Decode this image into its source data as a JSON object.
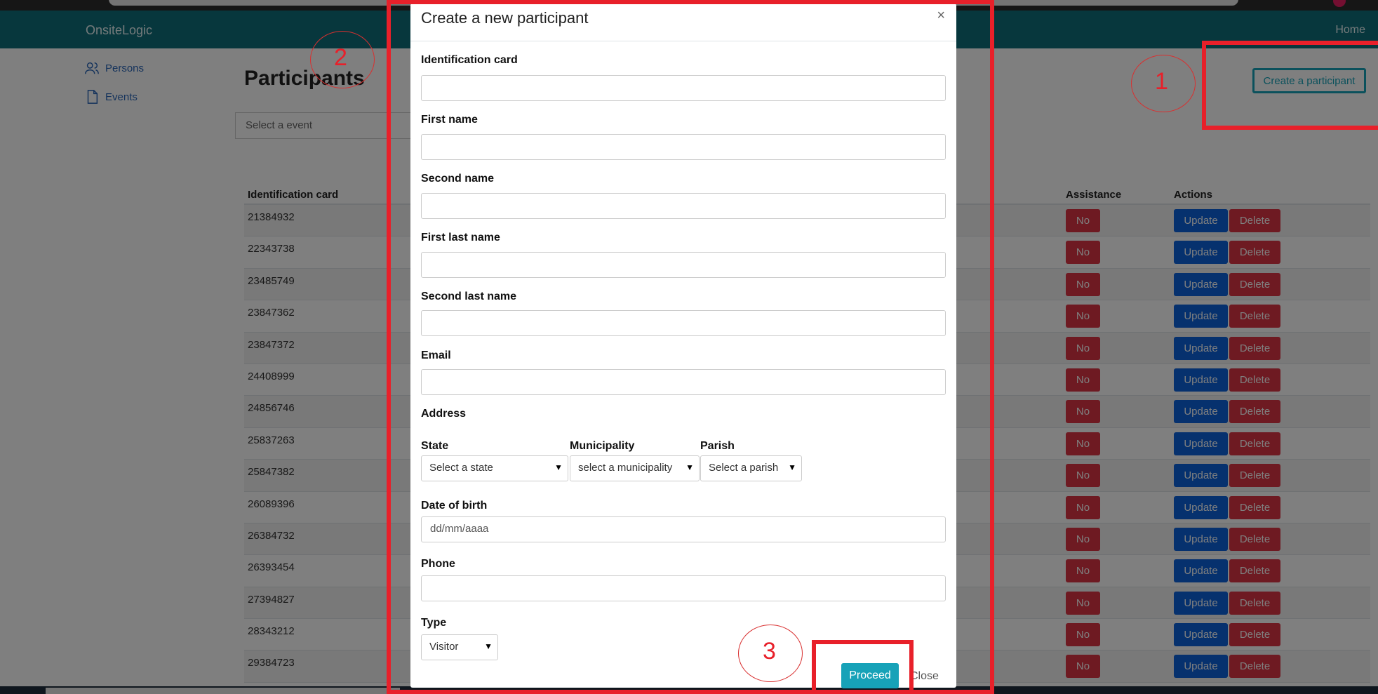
{
  "app": {
    "brand": "OnsiteLogic",
    "nav_home": "Home"
  },
  "sidebar": {
    "items": [
      {
        "label": "Persons",
        "icon": "users-icon"
      },
      {
        "label": "Events",
        "icon": "document-icon"
      }
    ]
  },
  "page": {
    "title": "Participants",
    "event_select_placeholder": "Select a event",
    "create_button": "Create a participant"
  },
  "table": {
    "headers": {
      "identification_card": "Identification card",
      "assistance": "Assistance",
      "actions": "Actions"
    },
    "rows": [
      {
        "id": "21384932",
        "assistance": "No"
      },
      {
        "id": "22343738",
        "assistance": "No"
      },
      {
        "id": "23485749",
        "assistance": "No"
      },
      {
        "id": "23847362",
        "assistance": "No"
      },
      {
        "id": "23847372",
        "assistance": "No"
      },
      {
        "id": "24408999",
        "assistance": "No"
      },
      {
        "id": "24856746",
        "assistance": "No"
      },
      {
        "id": "25837263",
        "assistance": "No"
      },
      {
        "id": "25847382",
        "assistance": "No"
      },
      {
        "id": "26089396",
        "assistance": "No"
      },
      {
        "id": "26384732",
        "assistance": "No"
      },
      {
        "id": "26393454",
        "assistance": "No"
      },
      {
        "id": "27394827",
        "assistance": "No"
      },
      {
        "id": "28343212",
        "assistance": "No"
      },
      {
        "id": "29384723",
        "assistance": "No"
      }
    ],
    "update_label": "Update",
    "delete_label": "Delete"
  },
  "modal": {
    "title": "Create a new participant",
    "close_x": "×",
    "fields": {
      "identification_card": "Identification card",
      "first_name": "First name",
      "second_name": "Second name",
      "first_last_name": "First last name",
      "second_last_name": "Second last name",
      "email": "Email",
      "address": "Address",
      "state": "State",
      "municipality": "Municipality",
      "parish": "Parish",
      "date_of_birth": "Date of birth",
      "phone": "Phone",
      "type": "Type"
    },
    "selects": {
      "state": "Select a state",
      "municipality": "select a municipality",
      "parish": "Select a parish",
      "type": "Visitor"
    },
    "date_placeholder": "dd/mm/aaaa",
    "proceed_label": "Proceed",
    "close_label": "Close"
  },
  "annotations": {
    "labels": [
      "1",
      "2",
      "3"
    ],
    "color": "#e8202a"
  },
  "colors": {
    "navbar": "#0f6f7a",
    "accent": "#17a2b8",
    "danger": "#dc3545",
    "primary": "#0d63dc"
  }
}
